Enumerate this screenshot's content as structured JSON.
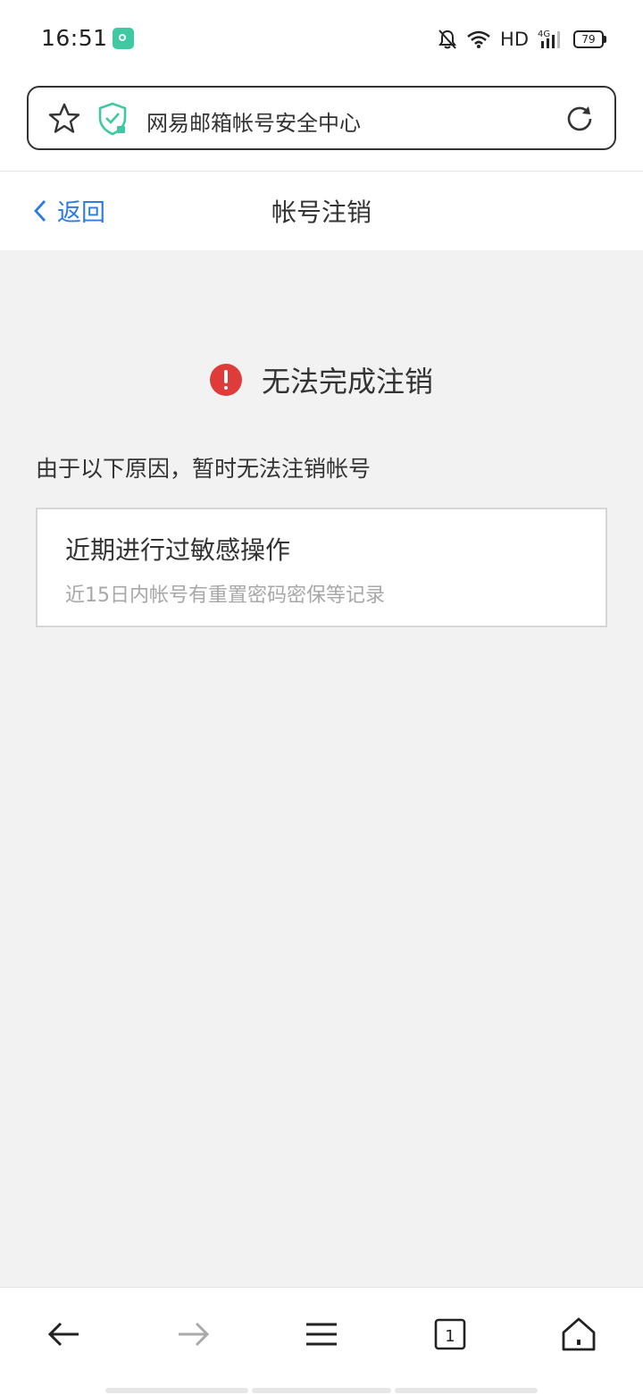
{
  "status_bar": {
    "time": "16:51",
    "network_label": "HD",
    "cell_label": "4G",
    "battery_level": "79"
  },
  "browser": {
    "page_title": "网易邮箱帐号安全中心"
  },
  "nav": {
    "back_label": "返回",
    "title": "帐号注销"
  },
  "content": {
    "error_title": "无法完成注销",
    "reason_intro": "由于以下原因，暂时无法注销帐号",
    "reasons": [
      {
        "title": "近期进行过敏感操作",
        "description": "近15日内帐号有重置密码密保等记录"
      }
    ]
  },
  "toolbar": {
    "tab_count": "1"
  },
  "colors": {
    "accent": "#2d7be5",
    "error": "#e03b3b",
    "shield": "#3fc9a3"
  }
}
